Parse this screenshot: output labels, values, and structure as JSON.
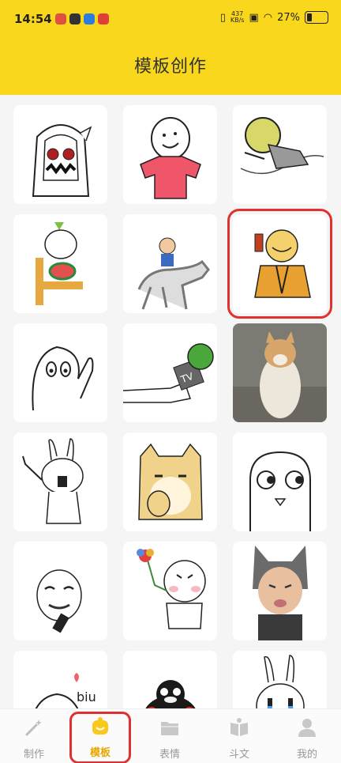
{
  "status_bar": {
    "time": "14:54",
    "speed_value": "437",
    "speed_unit": "KB/s",
    "battery": "27%",
    "battery_level": 0.27
  },
  "header": {
    "title": "模板创作"
  },
  "templates": [
    {
      "name": "horned-girl"
    },
    {
      "name": "happy-face-pink-shirt"
    },
    {
      "name": "lying-yellow-head"
    },
    {
      "name": "radish-eating-melon"
    },
    {
      "name": "man-on-horse"
    },
    {
      "name": "guy-with-phone"
    },
    {
      "name": "ghost-hand-up"
    },
    {
      "name": "tv-microphone"
    },
    {
      "name": "shiba-dog-photo"
    },
    {
      "name": "rabbit-shouting"
    },
    {
      "name": "doge-thinking"
    },
    {
      "name": "side-eye-face"
    },
    {
      "name": "meme-face-with-phone"
    },
    {
      "name": "flower-face"
    },
    {
      "name": "cat-hat-baby"
    },
    {
      "name": "biu-ghost"
    },
    {
      "name": "kumamon"
    },
    {
      "name": "crying-rabbit"
    }
  ],
  "card_text": {
    "tv": "TV",
    "biu": "biu"
  },
  "tabs": [
    {
      "label": "制作",
      "icon": "magic-wand-icon"
    },
    {
      "label": "模板",
      "icon": "template-icon"
    },
    {
      "label": "表情",
      "icon": "folder-icon"
    },
    {
      "label": "斗文",
      "icon": "book-icon"
    },
    {
      "label": "我的",
      "icon": "user-icon"
    }
  ],
  "colors": {
    "accent": "#f9d71c",
    "highlight": "#e03030",
    "active_tab": "#e6a800"
  }
}
